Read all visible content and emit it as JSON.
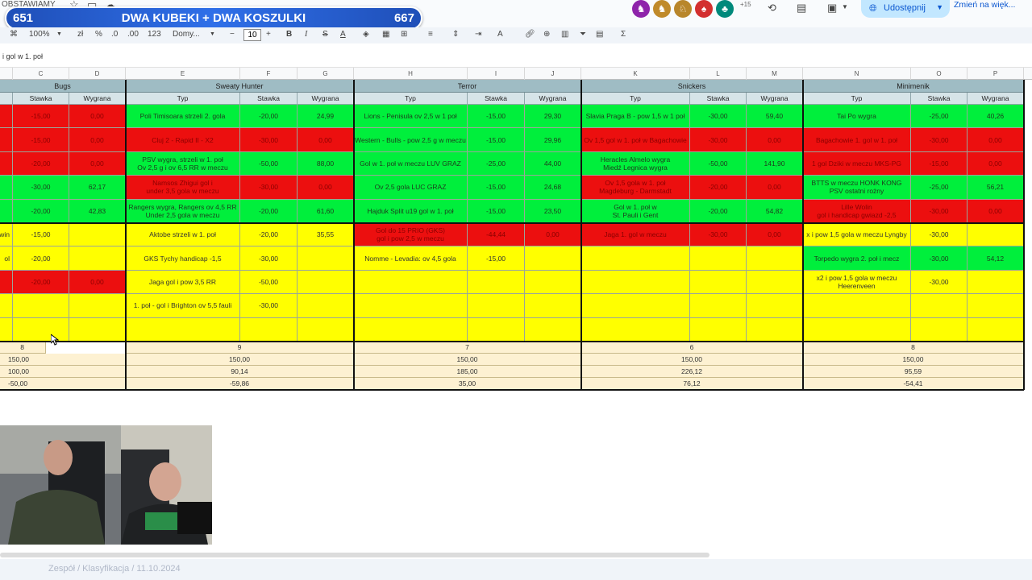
{
  "doc_title": "OBSTAWIAMY",
  "banner": {
    "left_number": "651",
    "title": "DWA KUBEKI + DWA KOSZULKI",
    "right_number": "667"
  },
  "share_button": "Udostępnij",
  "change_view": "Zmień na więk...",
  "avatars_more": "+15",
  "toolbar": {
    "zoom": "100%",
    "font": "Domy...",
    "font_size": "10",
    "percent": "%",
    "decimals_less": ".0",
    "decimals_more": ".00",
    "number_format": "123",
    "minus": "−",
    "plus": "+",
    "bold": "B",
    "italic": "I",
    "strike": "S",
    "text_color": "A",
    "sigma": "Σ"
  },
  "formula_text": "i gol w 1. poł",
  "col_headers": [
    "C",
    "D",
    "E",
    "F",
    "G",
    "H",
    "I",
    "J",
    "K",
    "L",
    "M",
    "N",
    "O",
    "P"
  ],
  "teams": [
    "Bugs",
    "Sweaty Hunter",
    "Terror",
    "Snickers",
    "Minimenik"
  ],
  "sub_headers": {
    "stawka": "Stawka",
    "wygrana": "Wygrana",
    "typ": "Typ"
  },
  "bugs_rows": [
    [
      "-15,00",
      "0,00"
    ],
    [
      "-15,00",
      "0,00"
    ],
    [
      "-20,00",
      "0,00"
    ],
    [
      "-30,00",
      "62,17"
    ],
    [
      "-20,00",
      "42,83"
    ],
    [
      "-15,00",
      ""
    ],
    [
      "-20,00",
      ""
    ],
    [
      "-20,00",
      "0,00"
    ],
    [
      "",
      ""
    ],
    [
      "",
      ""
    ]
  ],
  "bugs_left_labels": [
    "",
    "",
    "",
    "",
    "",
    "win",
    "ol",
    "",
    "",
    ""
  ],
  "sweaty_rows": [
    [
      "Poli Timisoara strzeli 2. gola",
      "-20,00",
      "24,99"
    ],
    [
      "Cluj 2 - Rapid II - X2",
      "-30,00",
      "0,00"
    ],
    [
      "PSV wygra, strzeli w 1. poł\nOv 2,5 g i ov 6,5 RR w meczu",
      "-50,00",
      "88,00"
    ],
    [
      "Namsos Zhigui gol i\nunder 3,5 gola w meczu",
      "-30,00",
      "0,00"
    ],
    [
      "Rangers wygra, Rangers ov 4,5 RR\nUnder 2,5 gola w meczu",
      "-20,00",
      "61,60"
    ],
    [
      "Aktobe strzeli w 1. poł",
      "-20,00",
      "35,55"
    ],
    [
      "GKS Tychy handicap -1,5",
      "-30,00",
      ""
    ],
    [
      "Jaga gol i pow 3,5 RR",
      "-50,00",
      ""
    ],
    [
      "1. poł - gol i Brighton ov 5,5 fauli",
      "-30,00",
      ""
    ],
    [
      "",
      "",
      ""
    ]
  ],
  "terror_rows": [
    [
      "Lions - Penisula ov 2,5 w 1 poł",
      "-15,00",
      "29,30"
    ],
    [
      "Western - Bulls - pow 2,5 g w meczu",
      "-15,00",
      "29,96"
    ],
    [
      "Gol w 1. poł w meczu LUV GRAZ",
      "-25,00",
      "44,00"
    ],
    [
      "Ov 2,5 gola LUC GRAZ",
      "-15,00",
      "24,68"
    ],
    [
      "Hajduk Split u19 gol w 1. poł",
      "-15,00",
      "23,50"
    ],
    [
      "Gol do 15 PRIO (GKS)\ngol i pow 2,5 w meczu",
      "-44,44",
      "0,00"
    ],
    [
      "Nomme - Levadia: ov 4,5 gola",
      "-15,00",
      ""
    ],
    [
      "",
      "",
      ""
    ],
    [
      "",
      "",
      ""
    ],
    [
      "",
      "",
      ""
    ]
  ],
  "snickers_rows": [
    [
      "Slavia Praga B - pow 1,5 w 1 poł",
      "-30,00",
      "59,40"
    ],
    [
      "Ov 1,5 gol w 1. poł w Bagachowie",
      "-30,00",
      "0,00"
    ],
    [
      "Heracles Almelo wygra\nMiedź Legnica wygra",
      "-50,00",
      "141,90"
    ],
    [
      "Ov 1,5 gola w 1. poł\nMagdeburg - Darmstadt",
      "-20,00",
      "0,00"
    ],
    [
      "Gol w 1. poł w\nSt. Pauli i Gent",
      "-20,00",
      "54,82"
    ],
    [
      "Jaga 1. gol w meczu",
      "-30,00",
      "0,00"
    ],
    [
      "",
      "",
      ""
    ],
    [
      "",
      "",
      ""
    ],
    [
      "",
      "",
      ""
    ],
    [
      "",
      "",
      ""
    ]
  ],
  "minimenik_rows": [
    [
      "Tai Po wygra",
      "-25,00",
      "40,26"
    ],
    [
      "Bagachowie 1. gol w 1. poł",
      "-30,00",
      "0,00"
    ],
    [
      "1 gol Dziki w meczu MKS-PG",
      "-15,00",
      "0,00"
    ],
    [
      "BTTS w meczu HONK KONG\nPSV ostatni rożny",
      "-25,00",
      "56,21"
    ],
    [
      "Lille Wolin\ngol i handicap gwiazd -2,5",
      "-30,00",
      "0,00"
    ],
    [
      "x i pow 1,5 gola w meczu Lyngby",
      "-30,00",
      ""
    ],
    [
      "Torpedo wygra 2. poł i mecz",
      "-30,00",
      "54,12"
    ],
    [
      "x2 i pow 1,5 gola w meczu\nHeerenveen",
      "-30,00",
      ""
    ],
    [
      "",
      "",
      ""
    ],
    [
      "",
      "",
      ""
    ]
  ],
  "summary": {
    "counts": [
      "8",
      "9",
      "7",
      "6",
      "8"
    ],
    "row_stake": [
      "150,00",
      "150,00",
      "150,00",
      "150,00",
      "150,00"
    ],
    "row_won": [
      "100,00",
      "90,14",
      "185,00",
      "226,12",
      "95,59"
    ],
    "row_balance": [
      "-50,00",
      "-59,86",
      "35,00",
      "76,12",
      "-54,41"
    ]
  },
  "bottom_sheet_tab": "Zespół / Klasyfikacja / 11.10.2024"
}
